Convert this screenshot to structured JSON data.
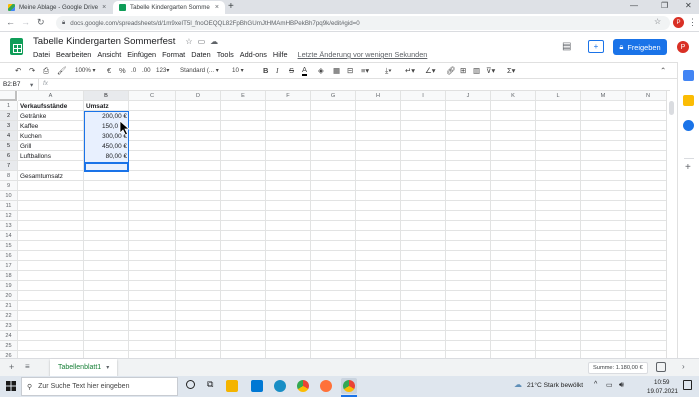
{
  "browser": {
    "tabs": [
      {
        "title": "Meine Ablage - Google Drive"
      },
      {
        "title": "Tabelle Kindergarten Sommerfest"
      }
    ],
    "tab_close": "×",
    "new_tab": "+",
    "url": "docs.google.com/spreadsheets/d/1m9xeIT5l_fnoOEQQL82FpBhGUmJtHMAmHBPekBh7pq9k/edit#gid=0"
  },
  "sheets": {
    "title": "Tabelle Kindergarten Sommerfest",
    "menus": [
      "Datei",
      "Bearbeiten",
      "Ansicht",
      "Einfügen",
      "Format",
      "Daten",
      "Tools",
      "Add-ons",
      "Hilfe"
    ],
    "last_edit": "Letzte Änderung vor wenigen Sekunden",
    "share_label": "Freigeben",
    "avatar_letter": "P",
    "toolbar": {
      "zoom": "100%",
      "currency": "€",
      "percent": "%",
      "dec_less": ".0",
      "dec_more": ".00",
      "num_format": "123",
      "font": "Standard (...",
      "font_size": "10",
      "bold": "B",
      "italic": "I",
      "strike": "S",
      "text_color": "A"
    },
    "name_box": "B2:B7",
    "fx": "fx",
    "columns": [
      "A",
      "B",
      "C",
      "D",
      "E",
      "F",
      "G",
      "H",
      "I",
      "J",
      "K",
      "L",
      "M",
      "N"
    ],
    "rows": [
      "1",
      "2",
      "3",
      "4",
      "5",
      "6",
      "7",
      "8",
      "9",
      "10",
      "11",
      "12",
      "13",
      "14",
      "15",
      "16",
      "17",
      "18",
      "19",
      "20",
      "21",
      "22",
      "23",
      "24",
      "25",
      "26",
      "27"
    ],
    "cells": {
      "a1": "Verkaufsstände",
      "b1": "Umsatz",
      "a2": "Getränke",
      "b2": "200,00 €",
      "a3": "Kaffee",
      "b3": "150,0",
      "a4": "Kuchen",
      "b4": "300,00 €",
      "a5": "Grill",
      "b5": "450,00 €",
      "a6": "Luftballons",
      "b6": "80,00 €",
      "a8": "Gesamtumsatz"
    },
    "sheet_tab": "Tabellenblatt1",
    "sum": "Summe: 1.180,00 €"
  },
  "taskbar": {
    "search_placeholder": "Zur Suche Text hier eingeben",
    "weather": "21°C  Stark bewölkt",
    "time": "10:59",
    "date": "19.07.2021"
  },
  "colors": {
    "sheets_green": "#0f9d58",
    "share_blue": "#1a73e8",
    "selection_fill": "#e8f0fe",
    "selection_border": "#1a73e8"
  }
}
